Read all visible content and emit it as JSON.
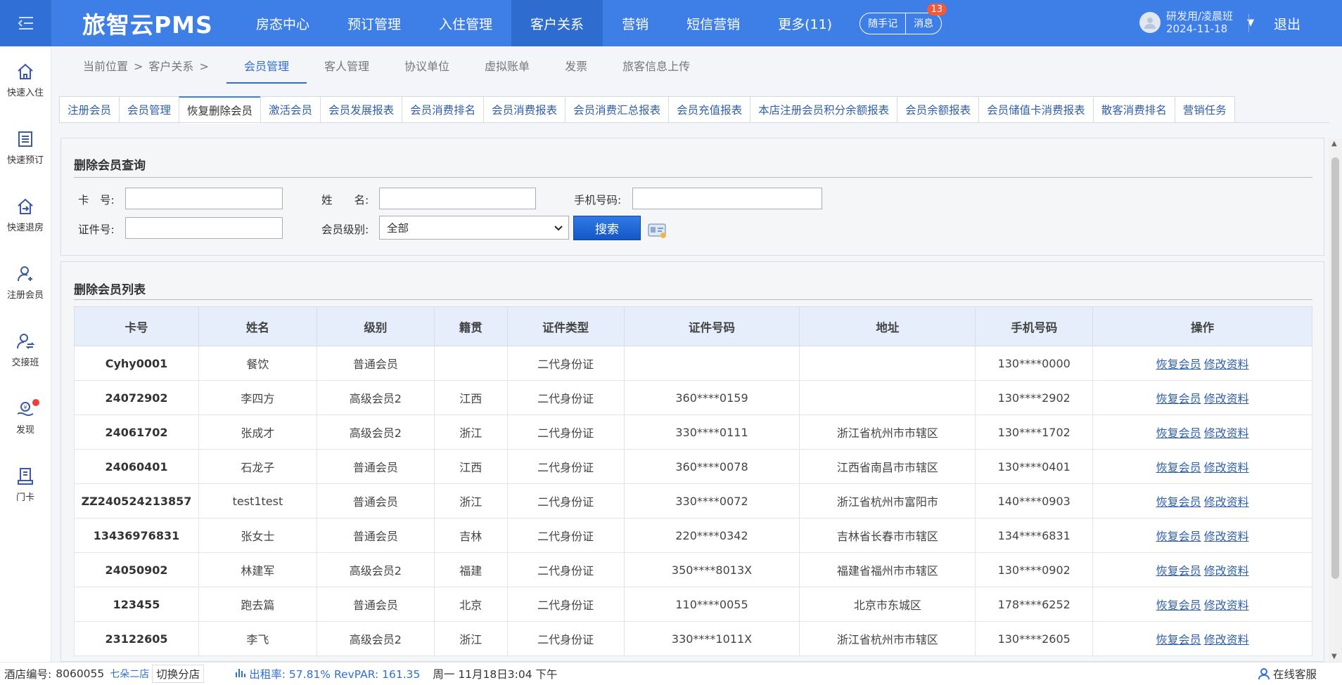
{
  "topbar": {
    "brand": "旅智云PMS",
    "nav": [
      "房态中心",
      "预订管理",
      "入住管理",
      "客户关系",
      "营销",
      "短信营销",
      "更多(11)"
    ],
    "active_nav": "客户关系",
    "memo_label": "随手记",
    "msg_label": "消息",
    "msg_count": "13",
    "user_name": "研发用/凌晨班",
    "user_date": "2024-11-18",
    "logout": "退出"
  },
  "sidebar": [
    {
      "label": "快速入住",
      "icon": "home-icon"
    },
    {
      "label": "快速预订",
      "icon": "document-icon"
    },
    {
      "label": "快速退房",
      "icon": "checkout-icon"
    },
    {
      "label": "注册会员",
      "icon": "add-user-icon"
    },
    {
      "label": "交接班",
      "icon": "shift-icon"
    },
    {
      "label": "发现",
      "icon": "discover-icon"
    },
    {
      "label": "门卡",
      "icon": "doorcard-icon"
    }
  ],
  "breadcrumb": {
    "current": "当前位置",
    "sep": ">",
    "section": "客户关系"
  },
  "subtabs": [
    "会员管理",
    "客人管理",
    "协议单位",
    "虚拟账单",
    "发票",
    "旅客信息上传"
  ],
  "tabs": [
    "注册会员",
    "会员管理",
    "恢复删除会员",
    "激活会员",
    "会员发展报表",
    "会员消费排名",
    "会员消费报表",
    "会员消费汇总报表",
    "会员充值报表",
    "本店注册会员积分余额报表",
    "会员余额报表",
    "会员储值卡消费报表",
    "散客消费排名",
    "营销任务"
  ],
  "search": {
    "title": "删除会员查询",
    "card_label": "卡　号:",
    "name_label": "姓　　名:",
    "phone_label": "手机号码:",
    "id_label": "证件号:",
    "level_label": "会员级别:",
    "level_value": "全部",
    "search_button": "搜索"
  },
  "list": {
    "title": "删除会员列表",
    "headers": [
      "卡号",
      "姓名",
      "级别",
      "籍贯",
      "证件类型",
      "证件号码",
      "地址",
      "手机号码",
      "操作"
    ],
    "restore_label": "恢复会员",
    "edit_label": "修改资料",
    "rows": [
      [
        "Cyhy0001",
        "餐饮",
        "普通会员",
        "",
        "二代身份证",
        "",
        "",
        "130****0000"
      ],
      [
        "24072902",
        "李四方",
        "高级会员2",
        "江西",
        "二代身份证",
        "360****0159",
        "",
        "130****2902"
      ],
      [
        "24061702",
        "张成才",
        "高级会员2",
        "浙江",
        "二代身份证",
        "330****0111",
        "浙江省杭州市市辖区",
        "130****1702"
      ],
      [
        "24060401",
        "石龙子",
        "普通会员",
        "江西",
        "二代身份证",
        "360****0078",
        "江西省南昌市市辖区",
        "130****0401"
      ],
      [
        "ZZ240524213857",
        "test1test",
        "普通会员",
        "浙江",
        "二代身份证",
        "330****0072",
        "浙江省杭州市富阳市",
        "140****0903"
      ],
      [
        "13436976831",
        "张女士",
        "普通会员",
        "吉林",
        "二代身份证",
        "220****0342",
        "吉林省长春市市辖区",
        "134****6831"
      ],
      [
        "24050902",
        "林建军",
        "高级会员2",
        "福建",
        "二代身份证",
        "350****8013X",
        "福建省福州市市辖区",
        "130****0902"
      ],
      [
        "123455",
        "跑去篇",
        "普通会员",
        "北京",
        "二代身份证",
        "110****0055",
        "北京市东城区",
        "178****6252"
      ],
      [
        "23122605",
        "李飞",
        "高级会员2",
        "浙江",
        "二代身份证",
        "330****1011X",
        "浙江省杭州市市辖区",
        "130****2605"
      ]
    ]
  },
  "status": {
    "hotel_label": "酒店编号:",
    "hotel_no": "8060055",
    "hotel_name": "七朵二店",
    "switch": "切换分店",
    "occupancy": "出租率:  57.81% RevPAR:  161.35",
    "datetime": "周一 11月18日3:04 下午",
    "service": "在线客服"
  }
}
